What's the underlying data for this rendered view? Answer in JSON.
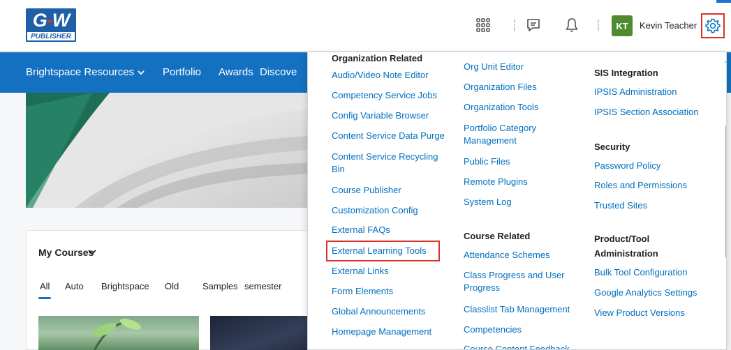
{
  "header": {
    "logo": {
      "main_left": "G",
      "main_dash": "-",
      "main_right": "W",
      "sub": "PUBLISHER"
    },
    "user": {
      "initials": "KT",
      "name": "Kevin Teacher"
    },
    "icons": [
      "waffle-grid-icon",
      "chat-icon",
      "bell-icon",
      "gear-icon"
    ],
    "colors": {
      "avatar": "#4f8a2e",
      "nav": "#1471c2",
      "link": "#006fbf",
      "highlight": "#d9342b"
    }
  },
  "navbar": {
    "items": [
      "Brightspace Resources",
      "Portfolio",
      "Awards",
      "Discove"
    ]
  },
  "courses": {
    "title": "My Courses",
    "filters": [
      "All",
      "Auto",
      "Brightspace",
      "Old",
      "Samples",
      "semester"
    ]
  },
  "admin_menu": {
    "col1": {
      "header": "Organization Related",
      "items": [
        "Audio/Video Note Editor",
        "Competency Service Jobs",
        "Config Variable Browser",
        "Content Service Data Purge",
        "Content Service Recycling",
        "Bin",
        "Course Publisher",
        "Customization Config",
        "External FAQs",
        "External Learning Tools",
        "External Links",
        "Form Elements",
        "Global Announcements",
        "Homepage Management"
      ]
    },
    "col2": {
      "items_org": [
        "Org Unit Editor",
        "Organization Files",
        "Organization Tools",
        "Portfolio Category",
        "Management",
        "Public Files",
        "Remote Plugins",
        "System Log"
      ],
      "course_header": "Course Related",
      "items_course": [
        "Attendance Schemes",
        "Class Progress and User",
        "Progress",
        "Classlist Tab Management",
        "Competencies",
        "Course Content Feedback"
      ]
    },
    "col3": {
      "sis_header": "SIS Integration",
      "sis_items": [
        "IPSIS Administration",
        "IPSIS Section Association"
      ],
      "security_header": "Security",
      "security_items": [
        "Password Policy",
        "Roles and Permissions",
        "Trusted Sites"
      ],
      "product_header_1": "Product/Tool",
      "product_header_2": "Administration",
      "product_items": [
        "Bulk Tool Configuration",
        "Google Analytics Settings",
        "View Product Versions"
      ]
    },
    "highlighted_item": "External Learning Tools"
  }
}
